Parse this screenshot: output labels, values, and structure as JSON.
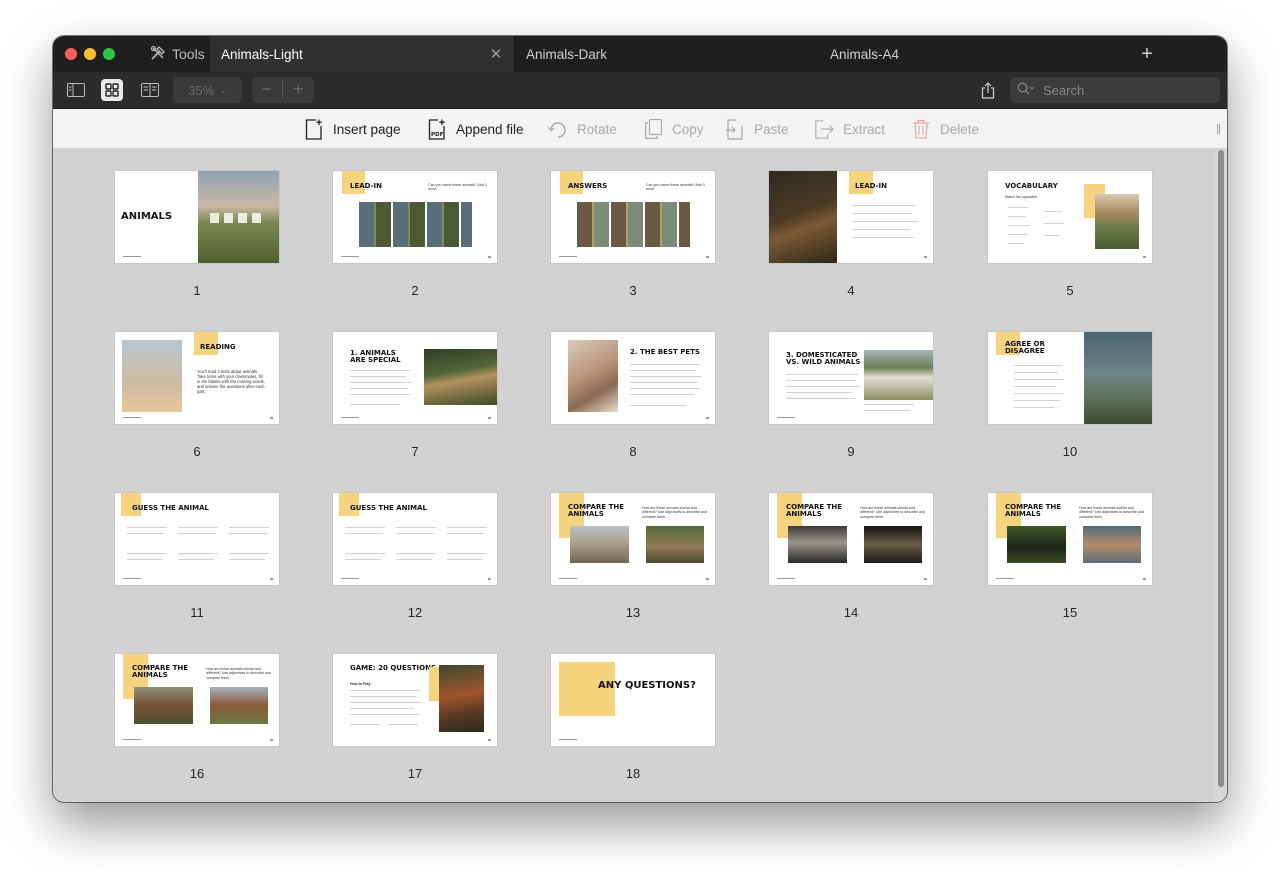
{
  "window": {
    "tools_label": "Tools",
    "tabs": [
      {
        "label": "Animals-Light",
        "active": true
      },
      {
        "label": "Animals-Dark",
        "active": false
      },
      {
        "label": "Animals-A4",
        "active": false
      }
    ],
    "add_tab_icon": "plus-icon",
    "close_tab_icon": "close-icon"
  },
  "toolbar": {
    "zoom": "35%",
    "zoom_out": "−",
    "zoom_in": "+",
    "search_placeholder": "Search",
    "view_buttons": [
      "sidebar-view-icon",
      "grid-view-icon",
      "book-view-icon"
    ]
  },
  "actions": [
    {
      "label": "Insert page",
      "enabled": true,
      "icon": "insert-page-icon"
    },
    {
      "label": "Append file",
      "enabled": true,
      "icon": "append-pdf-icon"
    },
    {
      "label": "Rotate",
      "enabled": false,
      "icon": "rotate-icon"
    },
    {
      "label": "Copy",
      "enabled": false,
      "icon": "copy-icon"
    },
    {
      "label": "Paste",
      "enabled": false,
      "icon": "paste-icon"
    },
    {
      "label": "Extract",
      "enabled": false,
      "icon": "extract-icon"
    },
    {
      "label": "Delete",
      "enabled": false,
      "icon": "delete-icon"
    }
  ],
  "pages": [
    {
      "n": "1",
      "title": "ANIMALS"
    },
    {
      "n": "2",
      "title": "LEAD-IN",
      "sub": "Can you name these animals? Add 3 more."
    },
    {
      "n": "3",
      "title": "ANSWERS",
      "sub": "Can you name these animals? Add 3 more."
    },
    {
      "n": "4",
      "title": "LEAD-IN"
    },
    {
      "n": "5",
      "title": "VOCABULARY",
      "sub": "Match the opposites"
    },
    {
      "n": "6",
      "title": "READING",
      "sub": "You'll read 3 texts about animals. Take turns with your classmates, fill in the blanks with the missing words, and answer the questions after each part."
    },
    {
      "n": "7",
      "title": "1. ANIMALS ARE SPECIAL"
    },
    {
      "n": "8",
      "title": "2. THE BEST PETS"
    },
    {
      "n": "9",
      "title": "3. DOMESTICATED VS. WILD ANIMALS"
    },
    {
      "n": "10",
      "title": "AGREE OR DISAGREE"
    },
    {
      "n": "11",
      "title": "GUESS THE ANIMAL"
    },
    {
      "n": "12",
      "title": "GUESS THE ANIMAL"
    },
    {
      "n": "13",
      "title": "COMPARE THE ANIMALS",
      "sub": "How are these animals similar and different? Use adjectives to describe and compare them."
    },
    {
      "n": "14",
      "title": "COMPARE THE ANIMALS",
      "sub": "How are these animals similar and different? Use adjectives to describe and compare them."
    },
    {
      "n": "15",
      "title": "COMPARE THE ANIMALS",
      "sub": "How are these animals similar and different? Use adjectives to describe and compare them."
    },
    {
      "n": "16",
      "title": "COMPARE THE ANIMALS",
      "sub": "How are these animals similar and different? Use adjectives to describe and compare them."
    },
    {
      "n": "17",
      "title": "GAME: 20 QUESTIONS",
      "sub": "How to Play:"
    },
    {
      "n": "18",
      "title": "ANY QUESTIONS?"
    }
  ],
  "colors": {
    "accent_yellow": "#f6d37d",
    "titlebar": "#1f1f1f",
    "canvas": "#d2d2d2"
  }
}
